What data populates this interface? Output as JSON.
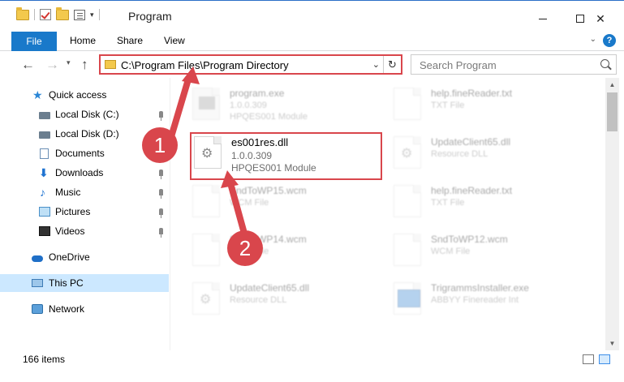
{
  "window": {
    "title": "Program",
    "minimize": "minimize",
    "maximize": "maximize",
    "close": "✕"
  },
  "ribbon": {
    "file": "File",
    "home": "Home",
    "share": "Share",
    "view": "View",
    "help": "?"
  },
  "navigation": {
    "back": "←",
    "forward": "→",
    "up": "↑",
    "recent": "▾",
    "address": "C:\\Program Files\\Program Directory",
    "address_dropdown": "⌄",
    "refresh": "↻",
    "search_placeholder": "Search Program"
  },
  "sidebar": {
    "items": [
      {
        "label": "Quick access",
        "icon": "star-icon"
      },
      {
        "label": "Local Disk (C:)",
        "icon": "disk-icon"
      },
      {
        "label": "Local Disk (D:)",
        "icon": "disk-icon"
      },
      {
        "label": "Documents",
        "icon": "document-icon"
      },
      {
        "label": "Downloads",
        "icon": "download-icon"
      },
      {
        "label": "Music",
        "icon": "music-icon"
      },
      {
        "label": "Pictures",
        "icon": "pictures-icon"
      },
      {
        "label": "Videos",
        "icon": "video-icon"
      },
      {
        "label": "OneDrive",
        "icon": "cloud-icon"
      },
      {
        "label": "This PC",
        "icon": "computer-icon"
      },
      {
        "label": "Network",
        "icon": "network-icon"
      }
    ]
  },
  "files": [
    {
      "name": "program.exe",
      "line2": "1.0.0.309",
      "line3": "HPQES001 Module"
    },
    {
      "name": "help.fineReader.txt",
      "line2": "TXT File",
      "line3": ""
    },
    {
      "name": "es001res.dll",
      "line2": "1.0.0.309",
      "line3": "HPQES001 Module"
    },
    {
      "name": "UpdateClient65.dll",
      "line2": "Resource DLL",
      "line3": ""
    },
    {
      "name": "SndToWP15.wcm",
      "line2": "WCM File",
      "line3": ""
    },
    {
      "name": "help.fineReader.txt",
      "line2": "TXT File",
      "line3": ""
    },
    {
      "name": "SndToWP14.wcm",
      "line2": "WCM File",
      "line3": ""
    },
    {
      "name": "SndToWP12.wcm",
      "line2": "WCM File",
      "line3": ""
    },
    {
      "name": "UpdateClient65.dll",
      "line2": "Resource DLL",
      "line3": ""
    },
    {
      "name": "TrigrammsInstaller.exe",
      "line2": "ABBYY Finereader Int",
      "line3": ""
    }
  ],
  "status": {
    "item_count": "166 items"
  },
  "annotations": {
    "step1": "1",
    "step2": "2",
    "color": "#d9464c"
  }
}
